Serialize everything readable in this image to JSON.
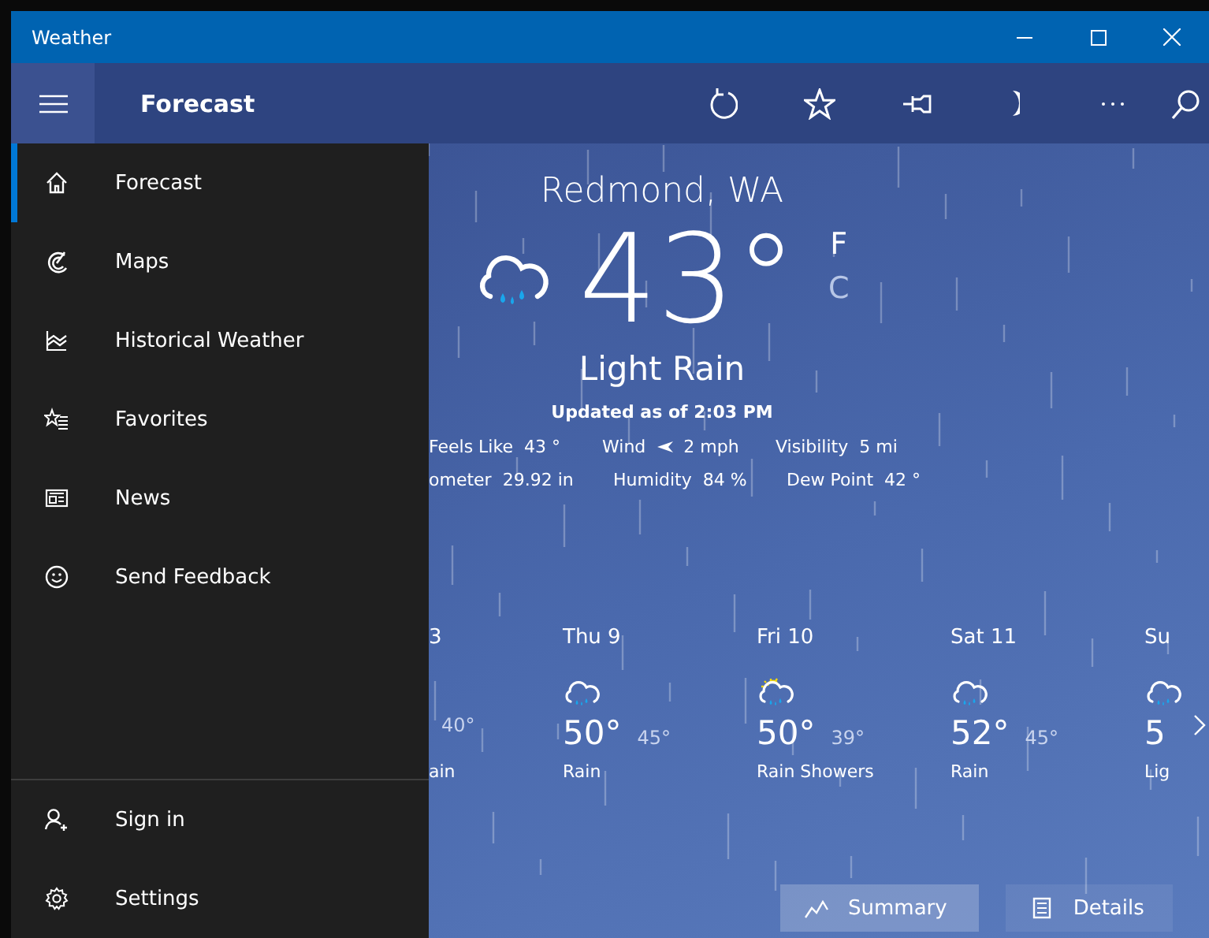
{
  "window": {
    "title": "Weather"
  },
  "toolbar": {
    "title": "Forecast"
  },
  "nav": {
    "items": [
      {
        "label": "Forecast",
        "selected": true
      },
      {
        "label": "Maps",
        "selected": false
      },
      {
        "label": "Historical Weather",
        "selected": false
      },
      {
        "label": "Favorites",
        "selected": false
      },
      {
        "label": "News",
        "selected": false
      },
      {
        "label": "Send Feedback",
        "selected": false
      }
    ],
    "footer": [
      {
        "label": "Sign in",
        "selected": false
      },
      {
        "label": "Settings",
        "selected": false
      }
    ]
  },
  "current": {
    "location": "Redmond, WA",
    "temperature": "43°",
    "units": [
      {
        "label": "F",
        "selected": true
      },
      {
        "label": "C",
        "selected": false
      }
    ],
    "condition": "Light Rain",
    "updated": "Updated as of 2:03 PM",
    "details": [
      [
        {
          "kind": "plain",
          "label": "Feels Like",
          "value": "43 °"
        },
        {
          "kind": "wind",
          "label": "Wind",
          "value": "2 mph"
        },
        {
          "kind": "plain",
          "label": "Visibility",
          "value": "5 mi"
        }
      ],
      [
        {
          "kind": "plain",
          "label": "ometer",
          "value": "29.92 in"
        },
        {
          "kind": "plain",
          "label": "Humidity",
          "value": "84 %"
        },
        {
          "kind": "plain",
          "label": "Dew Point",
          "value": "42 °"
        }
      ]
    ]
  },
  "days": [
    {
      "kind": "partial",
      "day": "3",
      "low": "40°",
      "condition": "ain"
    },
    {
      "kind": "rain",
      "day": "Thu 9",
      "high": "50°",
      "low": "45°",
      "condition": "Rain"
    },
    {
      "kind": "showers",
      "day": "Fri 10",
      "high": "50°",
      "low": "39°",
      "condition": "Rain Showers"
    },
    {
      "kind": "rain",
      "day": "Sat 11",
      "high": "52°",
      "low": "45°",
      "condition": "Rain"
    },
    {
      "kind": "rain",
      "day": "Su",
      "high": "5",
      "condition": "Lig"
    }
  ],
  "view_tabs": [
    {
      "label": "Summary",
      "selected": true
    },
    {
      "label": "Details",
      "selected": false
    }
  ]
}
